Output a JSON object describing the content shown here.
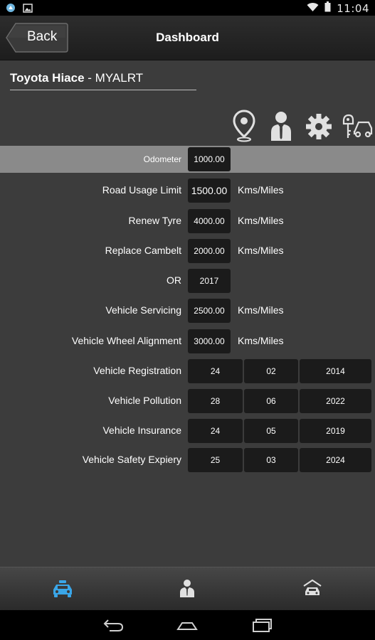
{
  "status_bar": {
    "time": "11:04"
  },
  "header": {
    "back_label": "Back",
    "title": "Dashboard"
  },
  "vehicle": {
    "make": "Toyota Hiace",
    "separator": " - ",
    "reg": "MYALRT"
  },
  "rows": [
    {
      "label": "Odometer",
      "value": "1000.00",
      "unit": ""
    },
    {
      "label": "Road Usage Limit",
      "value": "1500.00",
      "unit": "Kms/Miles"
    },
    {
      "label": "Renew Tyre",
      "value": "4000.00",
      "unit": "Kms/Miles"
    },
    {
      "label": "Replace Cambelt",
      "value": "2000.00",
      "unit": "Kms/Miles"
    },
    {
      "label": "OR",
      "value": "2017",
      "unit": ""
    },
    {
      "label": "Vehicle Servicing",
      "value": "2500.00",
      "unit": "Kms/Miles"
    },
    {
      "label": "Vehicle Wheel Alignment",
      "value": "3000.00",
      "unit": "Kms/Miles"
    }
  ],
  "date_rows": [
    {
      "label": "Vehicle Registration",
      "day": "24",
      "month": "02",
      "year": "2014"
    },
    {
      "label": "Vehicle Pollution",
      "day": "28",
      "month": "06",
      "year": "2022"
    },
    {
      "label": "Vehicle Insurance",
      "day": "24",
      "month": "05",
      "year": "2019"
    },
    {
      "label": "Vehicle Safety Expiery",
      "day": "25",
      "month": "03",
      "year": "2024"
    }
  ],
  "icons": {
    "tools": [
      "location-pin-icon",
      "person-icon",
      "gear-icon",
      "car-keys-icon"
    ],
    "tabs": [
      "car-icon",
      "driver-icon",
      "garage-icon"
    ],
    "nav": [
      "back-nav-icon",
      "home-nav-icon",
      "recents-nav-icon"
    ]
  },
  "colors": {
    "background": "#3c3c3c",
    "highlight_row": "#8a8a8a",
    "value_box": "#1b1b1b",
    "active_tab": "#3aa6e8",
    "icon": "#e0e0e0"
  }
}
